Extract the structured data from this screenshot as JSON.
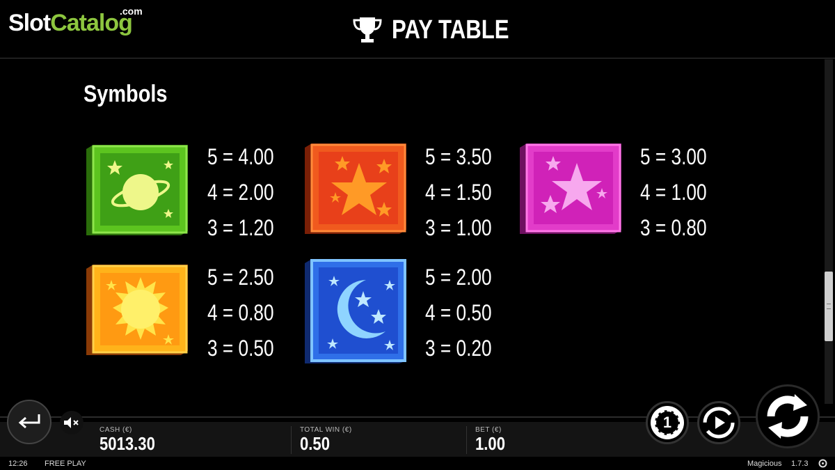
{
  "watermark": {
    "slot": "Slot",
    "catalog": "Catalog",
    "com": ".com"
  },
  "header": {
    "title": "PAY TABLE",
    "icon": "trophy-icon"
  },
  "section": {
    "title": "Symbols"
  },
  "symbols": [
    {
      "name": "planet",
      "color": "#5cc41f",
      "payouts": [
        "5 = 4.00",
        "4 = 2.00",
        "3 = 1.20"
      ]
    },
    {
      "name": "star-orange",
      "color": "#f05a1e",
      "payouts": [
        "5 = 3.50",
        "4 = 1.50",
        "3 = 1.00"
      ]
    },
    {
      "name": "stars-pink",
      "color": "#e23cc9",
      "payouts": [
        "5 = 3.00",
        "4 = 1.00",
        "3 = 0.80"
      ]
    },
    {
      "name": "sun",
      "color": "#ffb31a",
      "payouts": [
        "5 = 2.50",
        "4 = 0.80",
        "3 = 0.50"
      ]
    },
    {
      "name": "moon",
      "color": "#2f6fe8",
      "payouts": [
        "5 = 2.00",
        "4 = 0.50",
        "3 = 0.20"
      ]
    }
  ],
  "bottom": {
    "cash_label": "CASH (€)",
    "cash_value": "5013.30",
    "totalwin_label": "TOTAL WIN (€)",
    "totalwin_value": "0.50",
    "bet_label": "BET (€)",
    "bet_value": "1.00"
  },
  "status": {
    "time": "12:26",
    "mode": "FREE PLAY",
    "game": "Magicious",
    "version": "1.7.3"
  },
  "controls": {
    "back_icon": "return-arrow-icon",
    "mute_icon": "speaker-muted-icon",
    "coin_label": "1",
    "autoplay_icon": "autoplay-icon",
    "spin_icon": "spin-icon"
  }
}
